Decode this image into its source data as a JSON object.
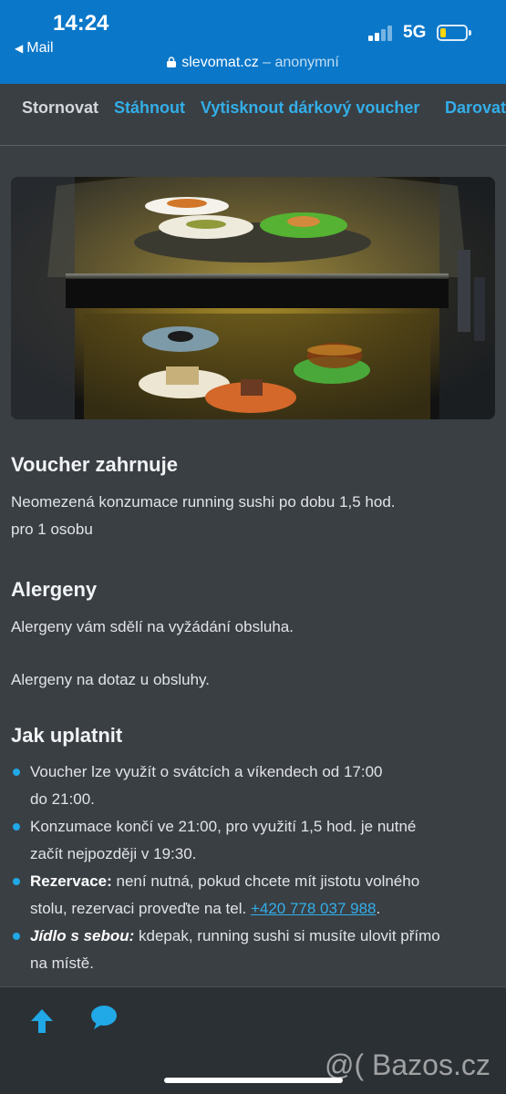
{
  "status_bar": {
    "time": "14:24",
    "back_app": "Mail",
    "network": "5G"
  },
  "url_bar": {
    "domain": "slevomat.cz",
    "suffix": " – anonymní"
  },
  "actions": {
    "cancel": "Stornovat",
    "download": "Stáhnout",
    "print": "Vytisknout dárkový voucher",
    "gift": "Darovat"
  },
  "hero_image": {
    "description": "running sushi conveyor"
  },
  "voucher": {
    "heading": "Voucher zahrnuje",
    "line1": "Neomezená konzumace running sushi po dobu 1,5 hod.",
    "line2": "pro 1 osobu"
  },
  "allergens": {
    "heading": "Alergeny",
    "line1": "Alergeny vám sdělí na vyžádání obsluha.",
    "line2": "Alergeny na dotaz u obsluhy."
  },
  "how_to": {
    "heading": "Jak uplatnit",
    "items": [
      {
        "line1": "Voucher lze využít o svátcích a víkendech od 17:00",
        "line2": "do 21:00."
      },
      {
        "line1": "Konzumace končí ve 21:00, pro využití 1,5 hod. je nutné",
        "line2": "začít nejpozději v 19:30."
      },
      {
        "bold": "Rezervace:",
        "line1": " není nutná, pokud chcete mít jistotu volného",
        "line2": "stolu, rezervaci proveďte na tel. ",
        "phone": "+420 778 037 988",
        "end": "."
      },
      {
        "bold": "Jídlo s sebou:",
        "line1": " kdepak, running sushi si musíte ulovit přímo",
        "line2": "na místě."
      }
    ]
  },
  "watermark": "@( Bazos.cz",
  "colors": {
    "header_blue": "#0a77c9",
    "link": "#33aee8",
    "bullet": "#21a8e6",
    "background": "#3a3f44"
  }
}
